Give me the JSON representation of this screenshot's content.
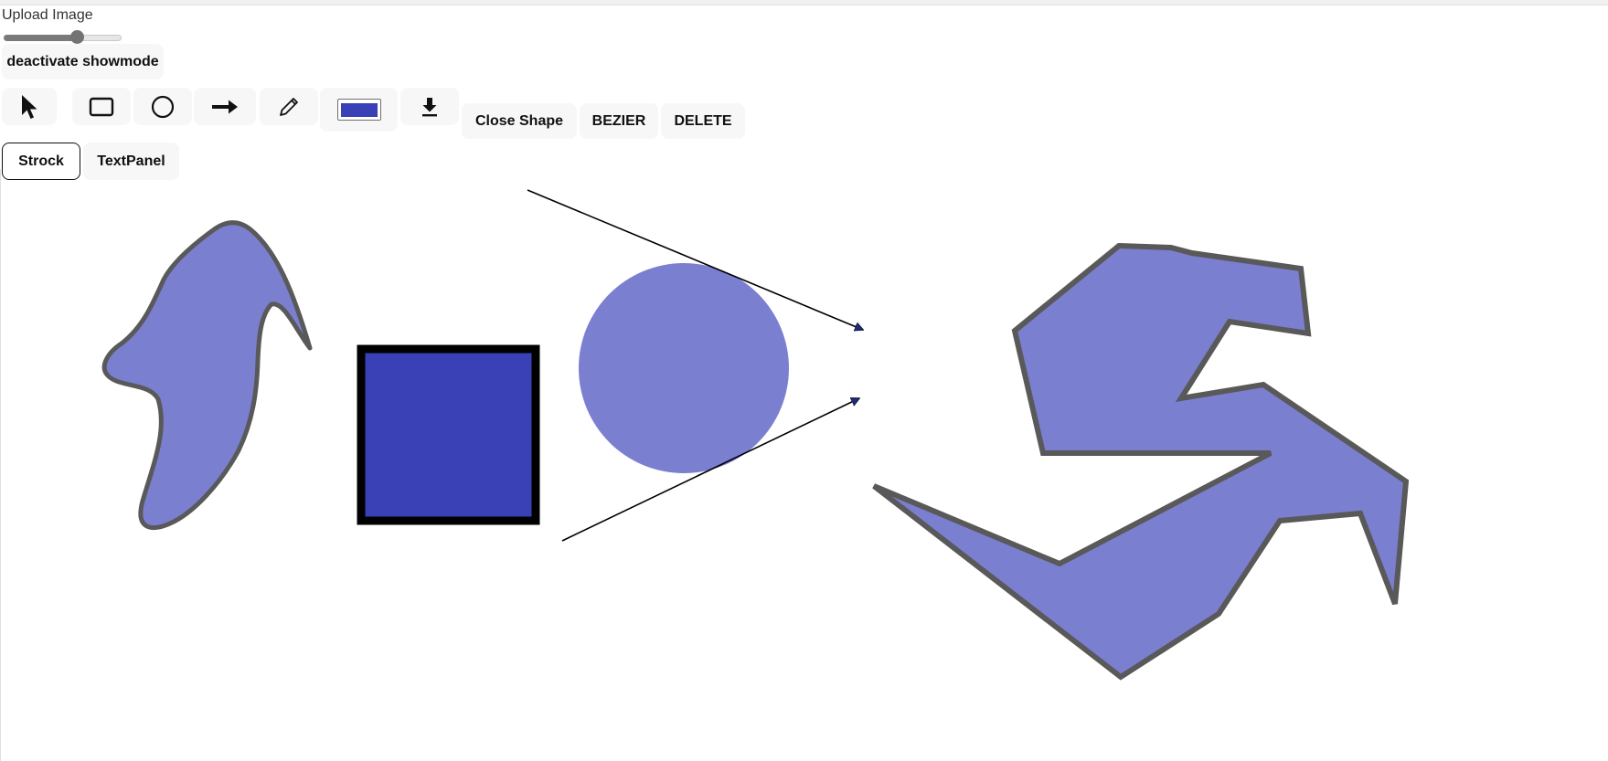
{
  "upload": {
    "label": "Upload Image"
  },
  "zoom_slider": {
    "value_fraction": 0.63
  },
  "showmode_button": {
    "label": "deactivate showmode"
  },
  "toolbar": {
    "tools": [
      {
        "icon": "cursor-icon",
        "name": "select"
      },
      {
        "icon": "rectangle-icon",
        "name": "rectangle"
      },
      {
        "icon": "circle-icon",
        "name": "circle"
      },
      {
        "icon": "arrow-right-icon",
        "name": "arrow"
      },
      {
        "icon": "pencil-icon",
        "name": "pencil"
      },
      {
        "icon": "color-swatch",
        "name": "color"
      },
      {
        "icon": "download-icon",
        "name": "download"
      }
    ],
    "close_shape_label": "Close Shape",
    "bezier_label": "BEZIER",
    "delete_label": "DELETE",
    "current_color": "#3a40b5"
  },
  "panels": {
    "strock_label": "Strock",
    "textpanel_label": "TextPanel",
    "active": "Strock"
  },
  "colors": {
    "shape_fill": "#7b7fd0",
    "shape_stroke": "#595959",
    "rect_fill": "#3a40b5",
    "rect_stroke": "#000000"
  }
}
